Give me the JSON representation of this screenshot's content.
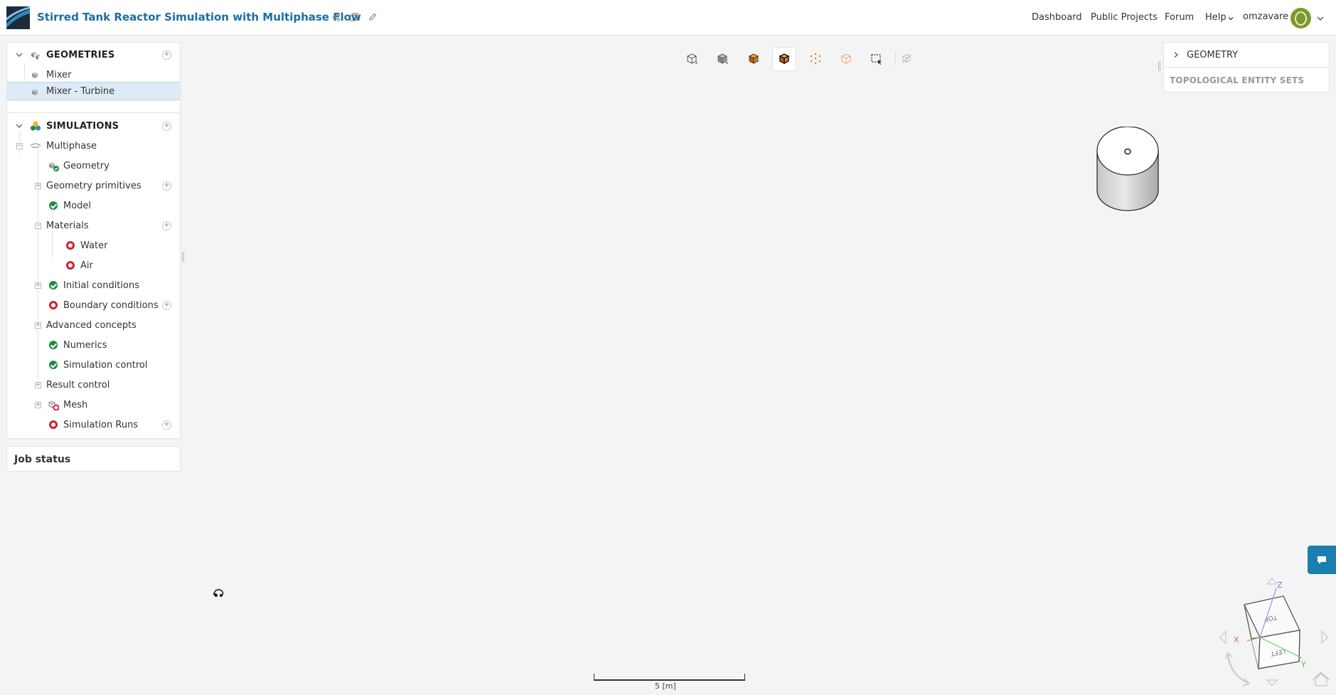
{
  "header": {
    "title": "Stirred Tank Reactor Simulation with Multiphase Flow",
    "nav": [
      "Dashboard",
      "Public Projects",
      "Forum",
      "Help"
    ],
    "username": "omzavare"
  },
  "tree": {
    "geometries_label": "GEOMETRIES",
    "geometries": [
      "Mixer",
      "Mixer - Turbine"
    ],
    "simulations_label": "SIMULATIONS",
    "simulation_name": "Multiphase",
    "items": {
      "geometry": "Geometry",
      "geometry_primitives": "Geometry primitives",
      "model": "Model",
      "materials": "Materials",
      "water": "Water",
      "air": "Air",
      "initial_conditions": "Initial conditions",
      "boundary_conditions": "Boundary conditions",
      "advanced_concepts": "Advanced concepts",
      "numerics": "Numerics",
      "simulation_control": "Simulation control",
      "result_control": "Result control",
      "mesh": "Mesh",
      "simulation_runs": "Simulation Runs"
    }
  },
  "job_status": "Job status",
  "right_panel": {
    "geometry": "GEOMETRY",
    "topological": "TOPOLOGICAL ENTITY SETS"
  },
  "viewport": {
    "scale_label": "5 [m]",
    "axes": {
      "x": "X",
      "y": "Y",
      "z": "Z"
    },
    "cube_faces": {
      "top": "TOP",
      "left": "LEFT"
    }
  },
  "colors": {
    "brand": "#1a6fa0",
    "ok": "#1f8a3c",
    "error": "#d0222d",
    "accent_orange": "#e07a1f"
  }
}
